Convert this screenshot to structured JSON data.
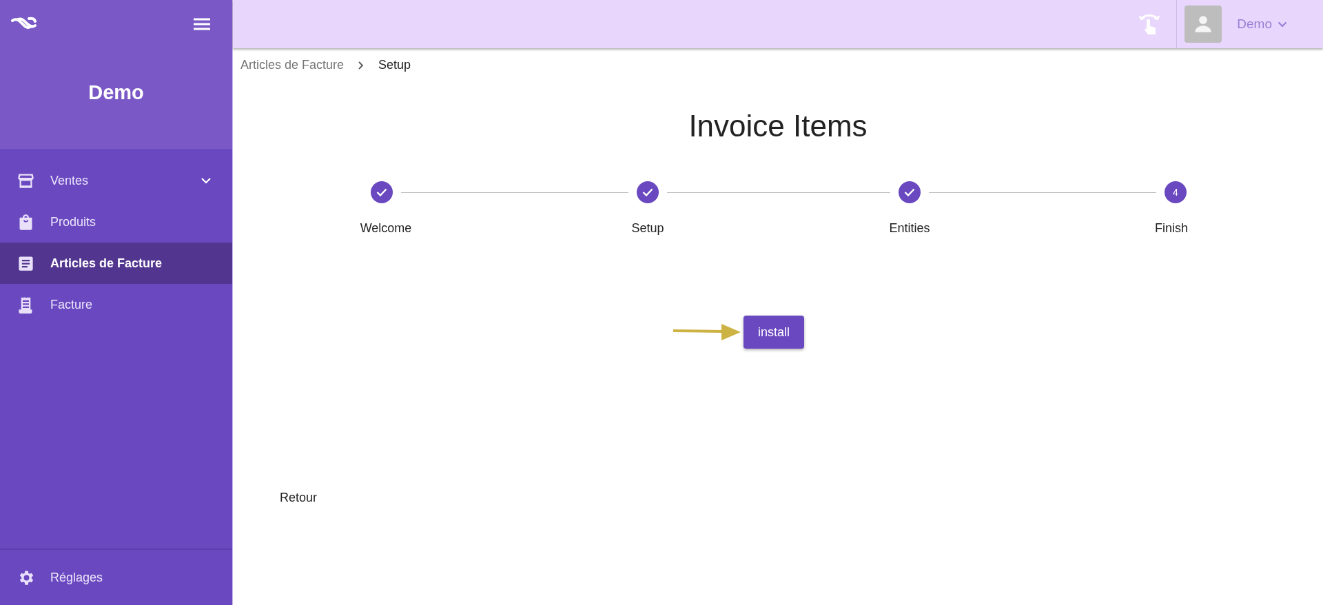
{
  "sidebar": {
    "title": "Demo",
    "items": [
      {
        "label": "Ventes",
        "selected": false,
        "expandable": true
      },
      {
        "label": "Produits",
        "selected": false,
        "expandable": false
      },
      {
        "label": "Articles de Facture",
        "selected": true,
        "expandable": false
      },
      {
        "label": "Facture",
        "selected": false,
        "expandable": false
      }
    ],
    "footer_item": {
      "label": "Réglages"
    }
  },
  "topbar": {
    "user": "Demo"
  },
  "breadcrumb": [
    {
      "label": "Articles de Facture",
      "current": false
    },
    {
      "label": "Setup",
      "current": true
    }
  ],
  "page_title": "Invoice Items",
  "steps": [
    {
      "label": "Welcome",
      "completed": true
    },
    {
      "label": "Setup",
      "completed": true
    },
    {
      "label": "Entities",
      "completed": true
    },
    {
      "label": "Finish",
      "completed": false,
      "number": "4"
    }
  ],
  "install_button": "install",
  "back_link": "Retour"
}
